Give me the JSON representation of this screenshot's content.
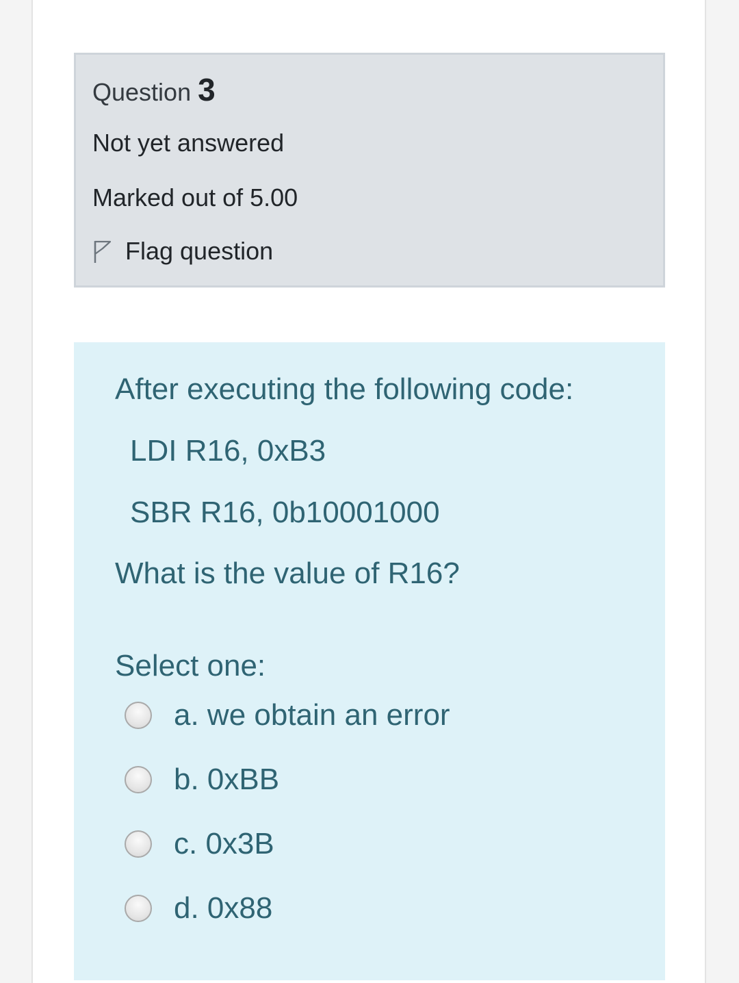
{
  "info": {
    "question_word": "Question",
    "question_number": "3",
    "state": "Not yet answered",
    "grade": "Marked out of 5.00",
    "flag_label": "Flag question",
    "flag_icon": "flag-outline-icon"
  },
  "content": {
    "prompt": "After executing the following code:",
    "code_lines": [
      "LDI R16, 0xB3",
      "SBR R16, 0b10001000"
    ],
    "question": "What is the value of R16?",
    "select_label": "Select one:",
    "options": [
      {
        "label": "a. we obtain an error",
        "selected": false
      },
      {
        "label": "b. 0xBB",
        "selected": false
      },
      {
        "label": "c. 0x3B",
        "selected": false
      },
      {
        "label": "d. 0x88",
        "selected": false
      }
    ]
  },
  "colors": {
    "info_background": "#dee2e6",
    "content_background": "#def2f8",
    "content_text": "#2f6473"
  }
}
